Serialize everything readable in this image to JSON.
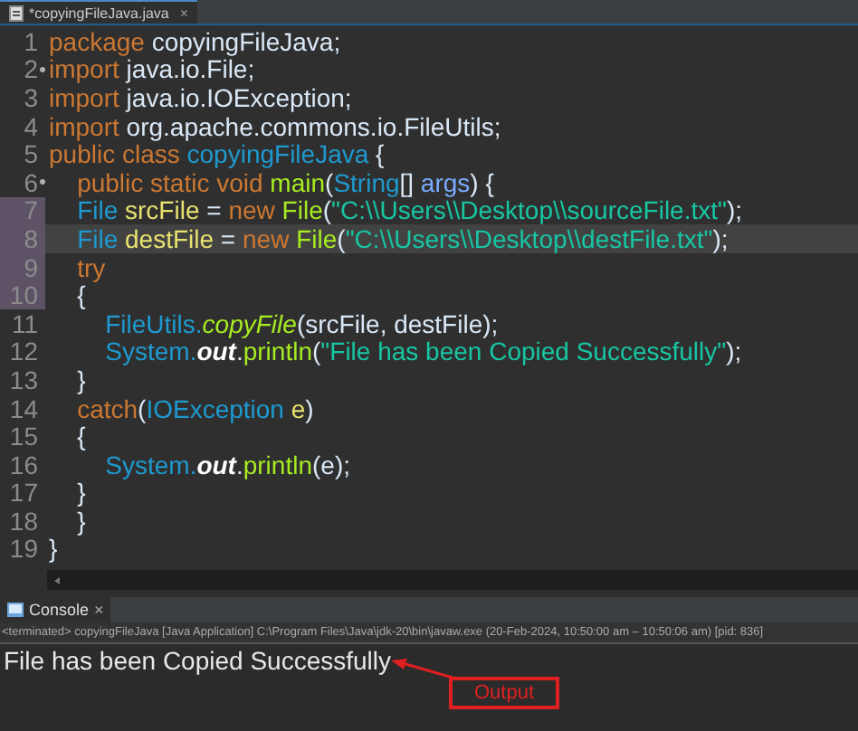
{
  "editor_tab": {
    "title": "*copyingFileJava.java",
    "close": "×"
  },
  "code_lines": [
    {
      "number": "1",
      "fold": false,
      "marked": false,
      "current": false,
      "tokens": [
        {
          "text": "package",
          "kind": "keyword"
        },
        {
          "text": " copyingFileJava;",
          "kind": "plain"
        }
      ]
    },
    {
      "number": "2",
      "fold": true,
      "marked": false,
      "current": false,
      "tokens": [
        {
          "text": "import",
          "kind": "keyword"
        },
        {
          "text": " java.io.File;",
          "kind": "plain"
        }
      ]
    },
    {
      "number": "3",
      "fold": false,
      "marked": false,
      "current": false,
      "tokens": [
        {
          "text": "import",
          "kind": "keyword"
        },
        {
          "text": " java.io.IOException;",
          "kind": "plain"
        }
      ]
    },
    {
      "number": "4",
      "fold": false,
      "marked": false,
      "current": false,
      "tokens": [
        {
          "text": "import",
          "kind": "keyword"
        },
        {
          "text": " org.apache.commons.io.FileUtils;",
          "kind": "plain"
        }
      ]
    },
    {
      "number": "5",
      "fold": false,
      "marked": false,
      "current": false,
      "tokens": [
        {
          "text": "public class",
          "kind": "keyword"
        },
        {
          "text": " copyingFileJava",
          "kind": "type"
        },
        {
          "text": " {",
          "kind": "plain"
        }
      ]
    },
    {
      "number": "6",
      "fold": true,
      "marked": false,
      "current": false,
      "tokens": [
        {
          "text": "\tpublic static void",
          "kind": "keyword"
        },
        {
          "text": " main",
          "kind": "method"
        },
        {
          "text": "(",
          "kind": "plain"
        },
        {
          "text": "String",
          "kind": "type"
        },
        {
          "text": "[]",
          "kind": "plain"
        },
        {
          "text": " args",
          "kind": "param"
        },
        {
          "text": ") {",
          "kind": "plain"
        }
      ]
    },
    {
      "number": "7",
      "fold": false,
      "marked": true,
      "current": false,
      "tokens": [
        {
          "text": "\tFile",
          "kind": "type"
        },
        {
          "text": " srcFile",
          "kind": "local"
        },
        {
          "text": " = ",
          "kind": "plain"
        },
        {
          "text": "new",
          "kind": "keyword"
        },
        {
          "text": " File",
          "kind": "method"
        },
        {
          "text": "(",
          "kind": "plain"
        },
        {
          "text": "\"C:\\\\Users\\\\Desktop\\\\sourceFile.txt\"",
          "kind": "string"
        },
        {
          "text": ");",
          "kind": "plain"
        }
      ]
    },
    {
      "number": "8",
      "fold": false,
      "marked": true,
      "current": true,
      "tokens": [
        {
          "text": "\tFile",
          "kind": "type"
        },
        {
          "text": " destFile",
          "kind": "local"
        },
        {
          "text": " = ",
          "kind": "plain"
        },
        {
          "text": "new",
          "kind": "keyword"
        },
        {
          "text": " File",
          "kind": "method"
        },
        {
          "text": "(",
          "kind": "plain"
        },
        {
          "text": "\"C:\\\\Users\\\\Desktop\\\\destFile.txt\"",
          "kind": "string"
        },
        {
          "text": ");",
          "kind": "plain"
        }
      ]
    },
    {
      "number": "9",
      "fold": false,
      "marked": true,
      "current": false,
      "tokens": [
        {
          "text": "\ttry",
          "kind": "keyword"
        }
      ]
    },
    {
      "number": "10",
      "fold": false,
      "marked": true,
      "current": false,
      "tokens": [
        {
          "text": "\t{",
          "kind": "plain"
        }
      ]
    },
    {
      "number": "11",
      "fold": false,
      "marked": false,
      "current": false,
      "tokens": [
        {
          "text": "\t\tFileUtils.",
          "kind": "type"
        },
        {
          "text": "copyFile",
          "kind": "static-method"
        },
        {
          "text": "(srcFile, destFile);",
          "kind": "plain"
        }
      ]
    },
    {
      "number": "12",
      "fold": false,
      "marked": false,
      "current": false,
      "tokens": [
        {
          "text": "\t\tSystem.",
          "kind": "type"
        },
        {
          "text": "out",
          "kind": "static-field"
        },
        {
          "text": ".",
          "kind": "plain"
        },
        {
          "text": "println",
          "kind": "method"
        },
        {
          "text": "(",
          "kind": "plain"
        },
        {
          "text": "\"File has been Copied Successfully\"",
          "kind": "string"
        },
        {
          "text": ");",
          "kind": "plain"
        }
      ]
    },
    {
      "number": "13",
      "fold": false,
      "marked": false,
      "current": false,
      "tokens": [
        {
          "text": "\t}",
          "kind": "plain"
        }
      ]
    },
    {
      "number": "14",
      "fold": false,
      "marked": false,
      "current": false,
      "tokens": [
        {
          "text": "\tcatch",
          "kind": "keyword"
        },
        {
          "text": "(",
          "kind": "plain"
        },
        {
          "text": "IOException",
          "kind": "type"
        },
        {
          "text": " e",
          "kind": "local"
        },
        {
          "text": ")",
          "kind": "plain"
        }
      ]
    },
    {
      "number": "15",
      "fold": false,
      "marked": false,
      "current": false,
      "tokens": [
        {
          "text": "\t{",
          "kind": "plain"
        }
      ]
    },
    {
      "number": "16",
      "fold": false,
      "marked": false,
      "current": false,
      "tokens": [
        {
          "text": "\t\tSystem.",
          "kind": "type"
        },
        {
          "text": "out",
          "kind": "static-field"
        },
        {
          "text": ".",
          "kind": "plain"
        },
        {
          "text": "println",
          "kind": "method"
        },
        {
          "text": "(e);",
          "kind": "plain"
        }
      ]
    },
    {
      "number": "17",
      "fold": false,
      "marked": false,
      "current": false,
      "tokens": [
        {
          "text": "\t}",
          "kind": "plain"
        }
      ]
    },
    {
      "number": "18",
      "fold": false,
      "marked": false,
      "current": false,
      "tokens": [
        {
          "text": "\t}",
          "kind": "plain"
        }
      ]
    },
    {
      "number": "19",
      "fold": false,
      "marked": false,
      "current": false,
      "tokens": [
        {
          "text": "}",
          "kind": "plain"
        }
      ]
    }
  ],
  "console": {
    "tab_title": "Console",
    "close": "×",
    "status": "<terminated> copyingFileJava [Java Application] C:\\Program Files\\Java\\jdk-20\\bin\\javaw.exe  (20-Feb-2024, 10:50:00 am – 10:50:06 am) [pid: 836]",
    "output": "File has been Copied Successfully"
  },
  "annotation": {
    "label": "Output"
  }
}
